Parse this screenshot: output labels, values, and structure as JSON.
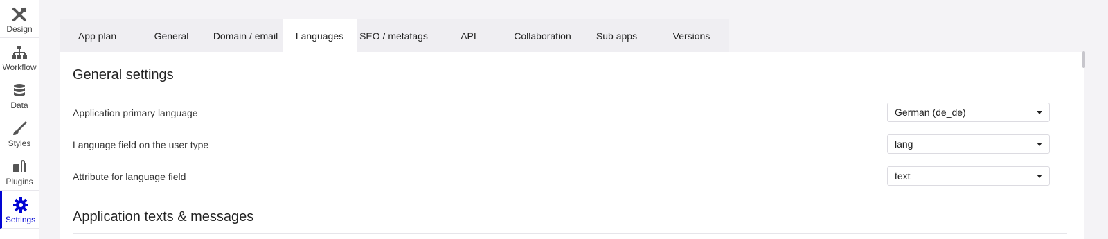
{
  "sidebar": {
    "items": [
      {
        "label": "Design",
        "icon": "design-tools-icon"
      },
      {
        "label": "Workflow",
        "icon": "workflow-icon"
      },
      {
        "label": "Data",
        "icon": "database-icon"
      },
      {
        "label": "Styles",
        "icon": "brush-icon"
      },
      {
        "label": "Plugins",
        "icon": "plugins-icon"
      },
      {
        "label": "Settings",
        "icon": "gear-icon"
      }
    ],
    "active": "Settings",
    "accent": "#0205d3"
  },
  "tabs": [
    {
      "label": "App plan"
    },
    {
      "label": "General"
    },
    {
      "label": "Domain / email"
    },
    {
      "label": "Languages"
    },
    {
      "label": "SEO / metatags"
    },
    {
      "label": "API"
    },
    {
      "label": "Collaboration"
    },
    {
      "label": "Sub apps"
    },
    {
      "label": "Versions"
    }
  ],
  "active_tab": "Languages",
  "general_settings": {
    "title": "General settings",
    "rows": [
      {
        "label": "Application primary language",
        "value": "German (de_de)"
      },
      {
        "label": "Language field on the user type",
        "value": "lang"
      },
      {
        "label": "Attribute for language field",
        "value": "text"
      }
    ]
  },
  "texts_section": {
    "title": "Application texts & messages"
  }
}
